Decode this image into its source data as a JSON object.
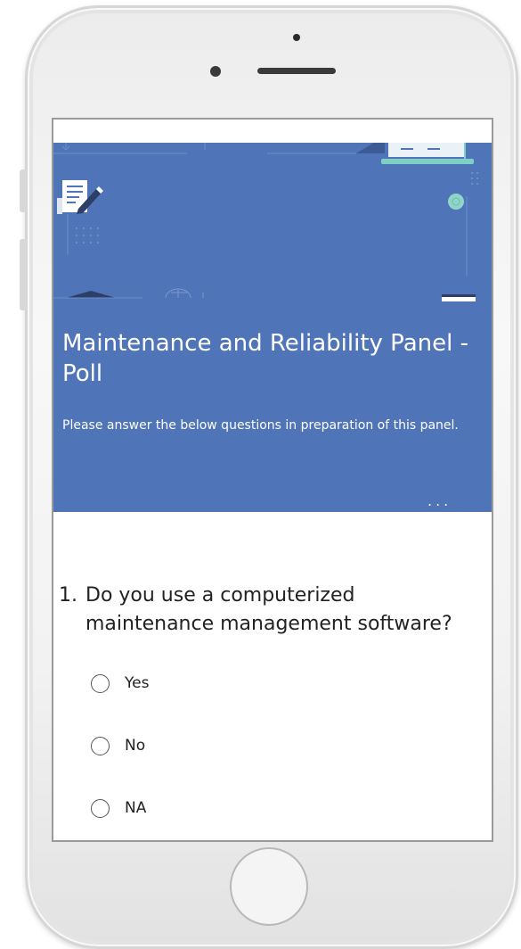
{
  "form": {
    "title": "Maintenance and Reliability Panel - Poll",
    "subtitle": "Please answer the below questions in preparation of this panel.",
    "more_label": "..."
  },
  "question": {
    "number": "1.",
    "text": "Do you use a computerized maintenance management software?",
    "options": [
      {
        "label": "Yes",
        "selected": false
      },
      {
        "label": "No",
        "selected": false
      },
      {
        "label": "NA",
        "selected": false
      }
    ]
  },
  "colors": {
    "header_bg": "#4f74b8",
    "text": "#222222"
  },
  "icons": {
    "header_icon": "document-pencil-icon"
  }
}
